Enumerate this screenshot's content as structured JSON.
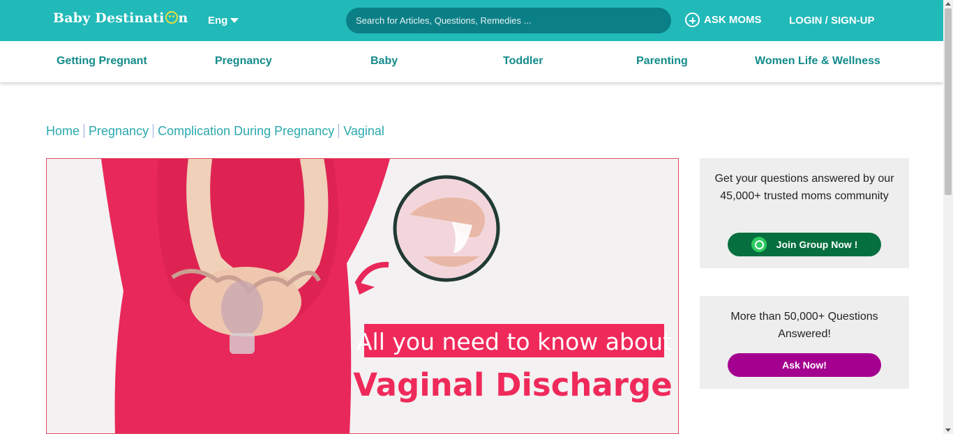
{
  "header": {
    "logo": "Baby Destination",
    "language": "Eng",
    "search_placeholder": "Search for Articles, Questions, Remedies ...",
    "ask_moms": "ASK MOMS",
    "login": "LOGIN / SIGN-UP"
  },
  "nav": {
    "items": [
      "Getting Pregnant",
      "Pregnancy",
      "Baby",
      "Toddler",
      "Parenting",
      "Women Life & Wellness"
    ]
  },
  "breadcrumb": [
    "Home",
    "Pregnancy",
    "Complication During Pregnancy",
    "Vaginal"
  ],
  "hero": {
    "line1": "All you need to know about",
    "line2": "Vaginal Discharge"
  },
  "sidebar": {
    "card1_text": "Get your questions answered by our 45,000+ trusted moms community",
    "card1_button": "Join Group Now !",
    "card2_text": "More than 50,000+ Questions Answered!",
    "card2_button": "Ask Now!"
  },
  "colors": {
    "brand": "#22b9b9",
    "nav_text": "#138b8b",
    "whatsapp_button": "#066f3f",
    "ask_button": "#a4008f",
    "hero_accent": "#ef2a5b"
  }
}
